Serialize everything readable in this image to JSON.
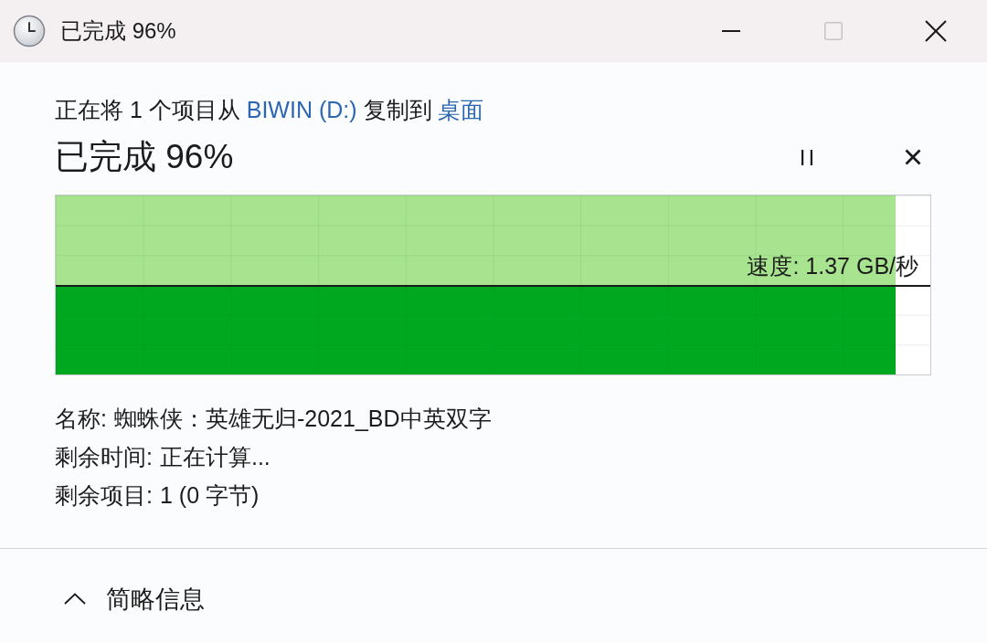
{
  "window": {
    "title": "已完成 96%",
    "controls": [
      {
        "kind": "minimize",
        "disabled": false
      },
      {
        "kind": "maximize",
        "disabled": true
      },
      {
        "kind": "close",
        "disabled": false
      }
    ]
  },
  "copy_line": {
    "prefix": "正在将 1 个项目从",
    "source": "BIWIN (D:)",
    "middle": "复制到",
    "destination": "桌面"
  },
  "progress": {
    "heading": "已完成 96%",
    "level": 0.96,
    "speed": "速度: 1.37 GB/秒"
  },
  "details": [
    {
      "label": "名称:",
      "value": "蜘蛛侠：英雄无归-2021_BD中英双字"
    },
    {
      "label": "剩余时间:",
      "value": "正在计算..."
    },
    {
      "label": "剩余项目:",
      "value": "1 (0 字节)"
    }
  ],
  "footer": {
    "label": "简略信息",
    "expanded": true
  }
}
